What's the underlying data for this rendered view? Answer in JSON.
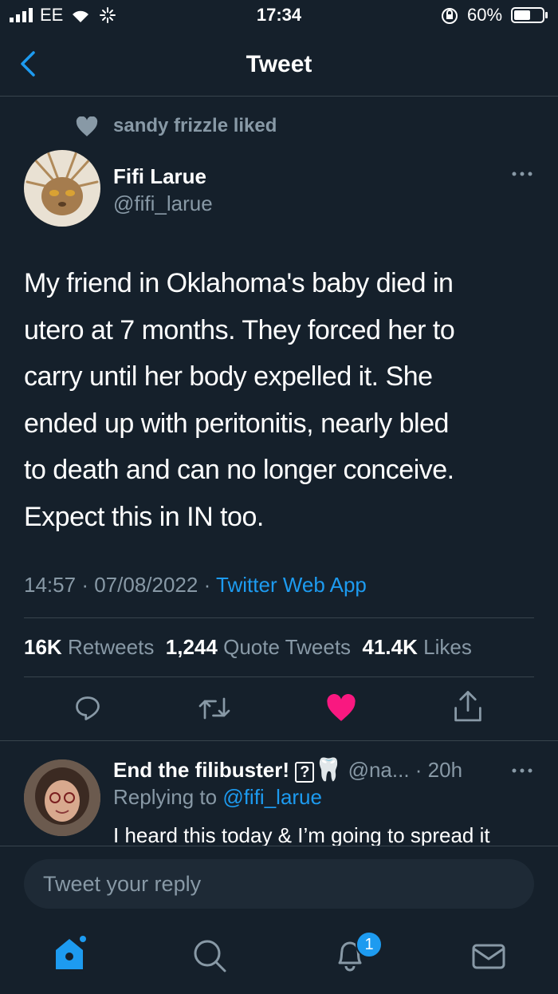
{
  "status_bar": {
    "carrier": "EE",
    "time": "17:34",
    "battery": "60%",
    "battery_level": 0.6
  },
  "header": {
    "title": "Tweet",
    "back_icon": "chevron-left-icon"
  },
  "social_context": {
    "text": "sandy frizzle liked",
    "icon": "heart-icon"
  },
  "tweet": {
    "author_name": "Fifi Larue",
    "author_handle": "@fifi_larue",
    "lines": [
      "My friend in Oklahoma's baby died in",
      "utero at 7 months. They forced her to",
      "carry until her body expelled it. She",
      "ended up with peritonitis, nearly bled",
      "to death and can no longer conceive.",
      "Expect this in IN too."
    ],
    "time": "14:57",
    "sep1": "·",
    "date": "07/08/2022",
    "sep2": "·",
    "source": "Twitter Web App",
    "stats": {
      "retweets_count": "16K",
      "retweets_label": "Retweets",
      "quotes_count": "1,244",
      "quotes_label": "Quote Tweets",
      "likes_count": "41.4K",
      "likes_label": "Likes"
    }
  },
  "actions": {
    "reply_icon": "reply-icon",
    "retweet_icon": "retweet-icon",
    "like_icon": "heart-filled-icon",
    "share_icon": "share-icon",
    "like_color": "#f91880"
  },
  "reply": {
    "author_name": "End the filibuster!",
    "badge": "?",
    "emoji": "🦷",
    "handle": "@na...",
    "time": "· 20h",
    "replying_prefix": "Replying to",
    "replying_handle": "@fifi_larue",
    "text": "I heard this today & I’m going to spread it"
  },
  "composer": {
    "placeholder": "Tweet your reply"
  },
  "tab_bar": {
    "notification_count": "1"
  },
  "colors": {
    "background": "#15202b",
    "accent": "#1d9bf0",
    "muted": "#8899a6",
    "divider": "#38444d"
  }
}
